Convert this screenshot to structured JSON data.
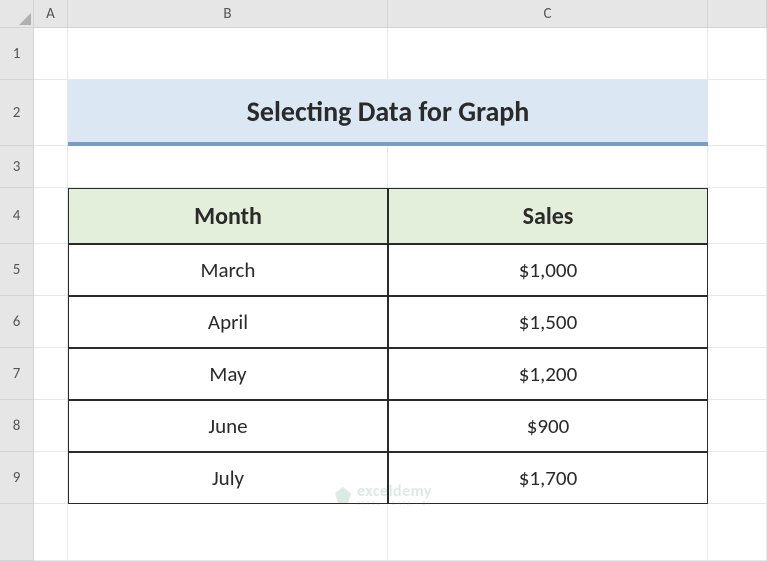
{
  "columns": [
    "A",
    "B",
    "C"
  ],
  "rows": [
    "1",
    "2",
    "3",
    "4",
    "5",
    "6",
    "7",
    "8",
    "9"
  ],
  "title": "Selecting Data for Graph",
  "table": {
    "headers": {
      "month": "Month",
      "sales": "Sales"
    },
    "data": [
      {
        "month": "March",
        "sales": "$1,000"
      },
      {
        "month": "April",
        "sales": "$1,500"
      },
      {
        "month": "May",
        "sales": "$1,200"
      },
      {
        "month": "June",
        "sales": "$900"
      },
      {
        "month": "July",
        "sales": "$1,700"
      }
    ]
  },
  "watermark": {
    "main": "exceldemy",
    "sub": "EXCEL · DATA · BI"
  },
  "chart_data": {
    "type": "table",
    "title": "Selecting Data for Graph",
    "categories": [
      "March",
      "April",
      "May",
      "June",
      "July"
    ],
    "values": [
      1000,
      1500,
      1200,
      900,
      1700
    ],
    "xlabel": "Month",
    "ylabel": "Sales"
  }
}
